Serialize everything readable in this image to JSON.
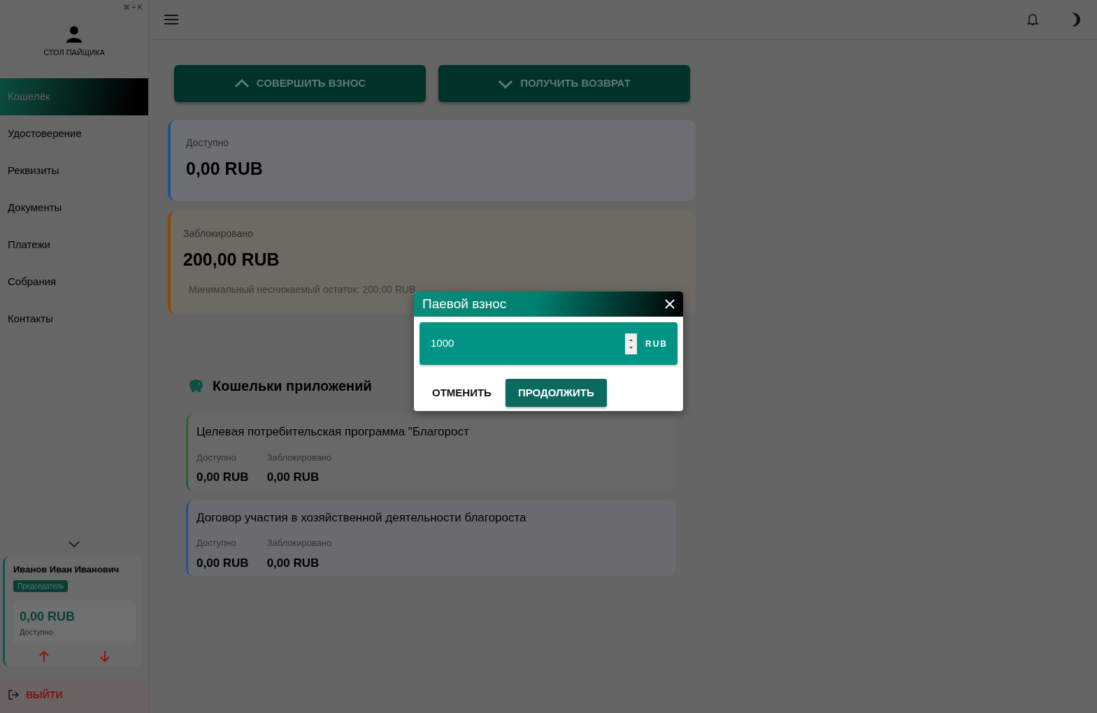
{
  "shortcut_hint": "⌘ + K",
  "sidebar": {
    "title": "СТОЛ ПАЙЩИКА",
    "items": [
      {
        "label": "Кошелёк",
        "selected": true
      },
      {
        "label": "Удостоверение",
        "selected": false
      },
      {
        "label": "Реквизиты",
        "selected": false
      },
      {
        "label": "Документы",
        "selected": false
      },
      {
        "label": "Платежи",
        "selected": false
      },
      {
        "label": "Собрания",
        "selected": false
      },
      {
        "label": "Контакты",
        "selected": false
      }
    ],
    "user_card": {
      "name": "Иванов Иван Иванович",
      "role": "Председатель",
      "balance": "0,00 RUB",
      "balance_label": "Доступно"
    },
    "logout": "ВЫЙТИ"
  },
  "actions": [
    {
      "label": "СОВЕРШИТЬ ВЗНОС",
      "kind": "deposit"
    },
    {
      "label": "ПОЛУЧИТЬ ВОЗВРАТ",
      "kind": "withdraw"
    }
  ],
  "balances": [
    {
      "label": "Доступно",
      "amount": "0,00 RUB",
      "color": "#24508f"
    },
    {
      "label": "Заблокировано",
      "amount": "200,00 RUB",
      "note": "Минимальный неснижаемый остаток: 200,00 RUB",
      "color": "#8a4a00"
    }
  ],
  "app_wallets": {
    "title": "Кошельки приложений",
    "items": [
      {
        "title": "Целевая потребительская программа \"Благорост",
        "color": "#2f5f2f",
        "available_label": "Доступно",
        "available": "0,00 RUB",
        "blocked_label": "Заблокировано",
        "blocked": "0,00 RUB"
      },
      {
        "title": "Договор участия в хозяйственной деятельности благороста",
        "color": "#24508f",
        "available_label": "Доступно",
        "available": "0,00 RUB",
        "blocked_label": "Заблокировано",
        "blocked": "0,00 RUB"
      }
    ]
  },
  "dialog": {
    "title": "Паевой взнос",
    "amount": "1000",
    "currency": "RUB",
    "buttons": [
      {
        "label": "ОТМЕНИТЬ",
        "kind": "text"
      },
      {
        "label": "ПРОДОЛЖИТЬ",
        "kind": "primary"
      }
    ]
  }
}
